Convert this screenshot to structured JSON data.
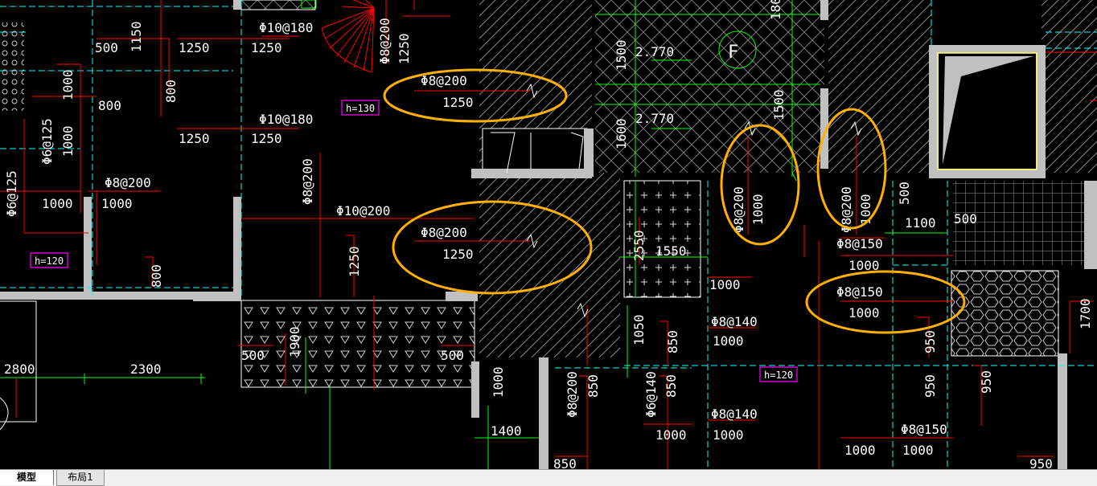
{
  "tabs": [
    {
      "label": "模型",
      "active": true
    },
    {
      "label": "布局1",
      "active": false
    }
  ],
  "colors": {
    "background": "#000000",
    "wall": "#c0c0c0",
    "dimension": "#ffffff",
    "rebar_red": "#ff0000",
    "grid_cyan": "#00ffff",
    "green": "#00ff00",
    "magenta": "#ff00ff",
    "highlight": "#ffb000"
  },
  "labels": [
    {
      "id": "l1",
      "text": "500"
    },
    {
      "id": "l2",
      "text": "1150"
    },
    {
      "id": "l3",
      "text": "1250"
    },
    {
      "id": "l4",
      "text": "Φ10@180"
    },
    {
      "id": "l5",
      "text": "1250"
    },
    {
      "id": "l6",
      "text": "Φ8@200"
    },
    {
      "id": "l7",
      "text": "1250"
    },
    {
      "id": "l8",
      "text": "1000"
    },
    {
      "id": "l9",
      "text": "800"
    },
    {
      "id": "l10",
      "text": "800"
    },
    {
      "id": "l11",
      "text": "Φ8@200"
    },
    {
      "id": "l12",
      "text": "1250"
    },
    {
      "id": "l13",
      "text": "Φ10@180"
    },
    {
      "id": "l14",
      "text": "1250"
    },
    {
      "id": "l15",
      "text": "1250"
    },
    {
      "id": "l16",
      "text": "Φ6@125"
    },
    {
      "id": "l17",
      "text": "1000"
    },
    {
      "id": "l18",
      "text": "Φ6@125"
    },
    {
      "id": "l19",
      "text": "Φ8@200"
    },
    {
      "id": "l20",
      "text": "1000"
    },
    {
      "id": "l21",
      "text": "1000"
    },
    {
      "id": "l22",
      "text": "Φ8@200"
    },
    {
      "id": "l23",
      "text": "Φ10@200"
    },
    {
      "id": "l24",
      "text": "Φ8@200"
    },
    {
      "id": "l25",
      "text": "1250"
    },
    {
      "id": "l26",
      "text": "1250"
    },
    {
      "id": "l27",
      "text": "800"
    },
    {
      "id": "l28",
      "text": "2.770"
    },
    {
      "id": "l29",
      "text": "2.770"
    },
    {
      "id": "l30",
      "text": "1500"
    },
    {
      "id": "l31",
      "text": "1600"
    },
    {
      "id": "l32",
      "text": "1500"
    },
    {
      "id": "l33",
      "text": "Φ8@200"
    },
    {
      "id": "l34",
      "text": "1000"
    },
    {
      "id": "l35",
      "text": "Φ8@200"
    },
    {
      "id": "l36",
      "text": "1000"
    },
    {
      "id": "l37",
      "text": "500"
    },
    {
      "id": "l38",
      "text": "1100"
    },
    {
      "id": "l39",
      "text": "500"
    },
    {
      "id": "l40",
      "text": "Φ8@150"
    },
    {
      "id": "l41",
      "text": "1000"
    },
    {
      "id": "l42",
      "text": "Φ8@150"
    },
    {
      "id": "l43",
      "text": "1000"
    },
    {
      "id": "l44",
      "text": "1550"
    },
    {
      "id": "l45",
      "text": "2550"
    },
    {
      "id": "l46",
      "text": "1000"
    },
    {
      "id": "l47",
      "text": "Φ8@140"
    },
    {
      "id": "l48",
      "text": "1000"
    },
    {
      "id": "l49",
      "text": "1050"
    },
    {
      "id": "l50",
      "text": "850"
    },
    {
      "id": "l51",
      "text": "950"
    },
    {
      "id": "l52",
      "text": "950"
    },
    {
      "id": "l53",
      "text": "950"
    },
    {
      "id": "l54",
      "text": "1700"
    },
    {
      "id": "l55",
      "text": "2800"
    },
    {
      "id": "l56",
      "text": "2300"
    },
    {
      "id": "l57",
      "text": "500"
    },
    {
      "id": "l58",
      "text": "1900"
    },
    {
      "id": "l59",
      "text": "500"
    },
    {
      "id": "l60",
      "text": "1000"
    },
    {
      "id": "l61",
      "text": "1400"
    },
    {
      "id": "l62",
      "text": "Φ8@200"
    },
    {
      "id": "l63",
      "text": "850"
    },
    {
      "id": "l64",
      "text": "Φ6@140"
    },
    {
      "id": "l65",
      "text": "850"
    },
    {
      "id": "l66",
      "text": "1000"
    },
    {
      "id": "l67",
      "text": "Φ8@140"
    },
    {
      "id": "l68",
      "text": "1000"
    },
    {
      "id": "l69",
      "text": "Φ8@150"
    },
    {
      "id": "l70",
      "text": "1000"
    },
    {
      "id": "l71",
      "text": "1000"
    },
    {
      "id": "l72",
      "text": "850"
    },
    {
      "id": "l73",
      "text": "950"
    },
    {
      "id": "l74",
      "text": "1800"
    }
  ],
  "tags": [
    {
      "id": "t1",
      "text": "h=130"
    },
    {
      "id": "t2",
      "text": "h=120"
    },
    {
      "id": "t3",
      "text": "h=120"
    }
  ],
  "grid_marker": "F"
}
